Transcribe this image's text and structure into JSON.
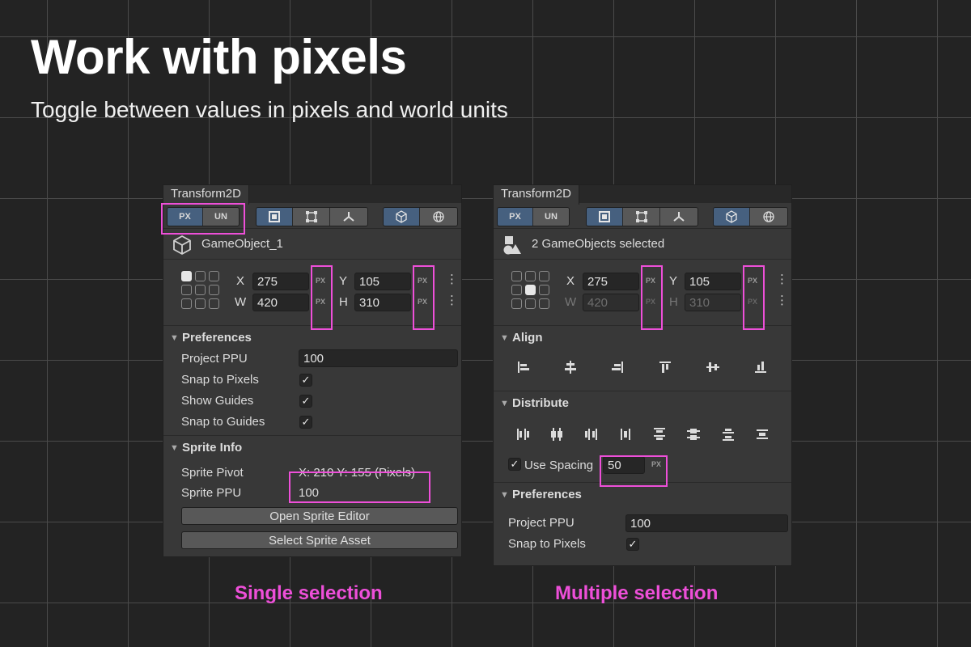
{
  "hero": {
    "title": "Work with pixels",
    "subtitle": "Toggle between values in pixels and world units"
  },
  "captions": {
    "left": "Single selection",
    "right": "Multiple selection"
  },
  "colors": {
    "accent": "#ee4fd9",
    "active_button": "#46607f",
    "background": "#232323",
    "panel": "#383838"
  },
  "left_panel": {
    "tab": "Transform2D",
    "units": {
      "px": "PX",
      "un": "UN",
      "active": "px"
    },
    "tool_icons": [
      "rect-tool-icon",
      "rect-handles-icon",
      "pivot-tool-icon",
      "local-space-icon",
      "world-space-icon"
    ],
    "object_name": "GameObject_1",
    "object_icon": "cube-icon",
    "transform": {
      "x_label": "X",
      "x": "275",
      "x_unit": "PX",
      "y_label": "Y",
      "y": "105",
      "y_unit": "PX",
      "w_label": "W",
      "w": "420",
      "w_unit": "PX",
      "h_label": "H",
      "h": "310",
      "h_unit": "PX",
      "anchor": "top-left"
    },
    "preferences": {
      "title": "Preferences",
      "project_ppu_label": "Project PPU",
      "project_ppu": "100",
      "snap_to_pixels_label": "Snap to Pixels",
      "snap_to_pixels": true,
      "show_guides_label": "Show Guides",
      "show_guides": false,
      "snap_to_guides_label": "Snap to Guides",
      "snap_to_guides": true
    },
    "sprite_info": {
      "title": "Sprite Info",
      "pivot_label": "Sprite Pivot",
      "pivot_value": "X: 210  Y: 155 (Pixels)",
      "ppu_label": "Sprite PPU",
      "ppu_value": "100",
      "open_editor": "Open Sprite Editor",
      "select_asset": "Select Sprite Asset"
    }
  },
  "right_panel": {
    "tab": "Transform2D",
    "units": {
      "px": "PX",
      "un": "UN",
      "active": "px"
    },
    "object_name": "2 GameObjects selected",
    "object_icon": "multi-shapes-icon",
    "transform": {
      "x_label": "X",
      "x": "275",
      "x_unit": "PX",
      "y_label": "Y",
      "y": "105",
      "y_unit": "PX",
      "w_label": "W",
      "w": "420",
      "w_unit": "PX",
      "h_label": "H",
      "h": "310",
      "h_unit": "PX",
      "anchor": "center"
    },
    "align": {
      "title": "Align",
      "icons": [
        "align-left-icon",
        "align-center-h-icon",
        "align-right-icon",
        "align-top-icon",
        "align-middle-v-icon",
        "align-bottom-icon"
      ]
    },
    "distribute": {
      "title": "Distribute",
      "icons": [
        "distribute-left-icon",
        "distribute-center-h-icon",
        "distribute-right-icon",
        "distribute-gap-h-icon",
        "distribute-top-icon",
        "distribute-center-v-icon",
        "distribute-bottom-icon",
        "distribute-gap-v-icon"
      ],
      "use_spacing_label": "Use Spacing",
      "use_spacing": true,
      "spacing": "50",
      "spacing_unit": "PX"
    },
    "preferences": {
      "title": "Preferences",
      "project_ppu_label": "Project PPU",
      "project_ppu": "100",
      "snap_to_pixels_label": "Snap to Pixels",
      "snap_to_pixels": true
    }
  }
}
